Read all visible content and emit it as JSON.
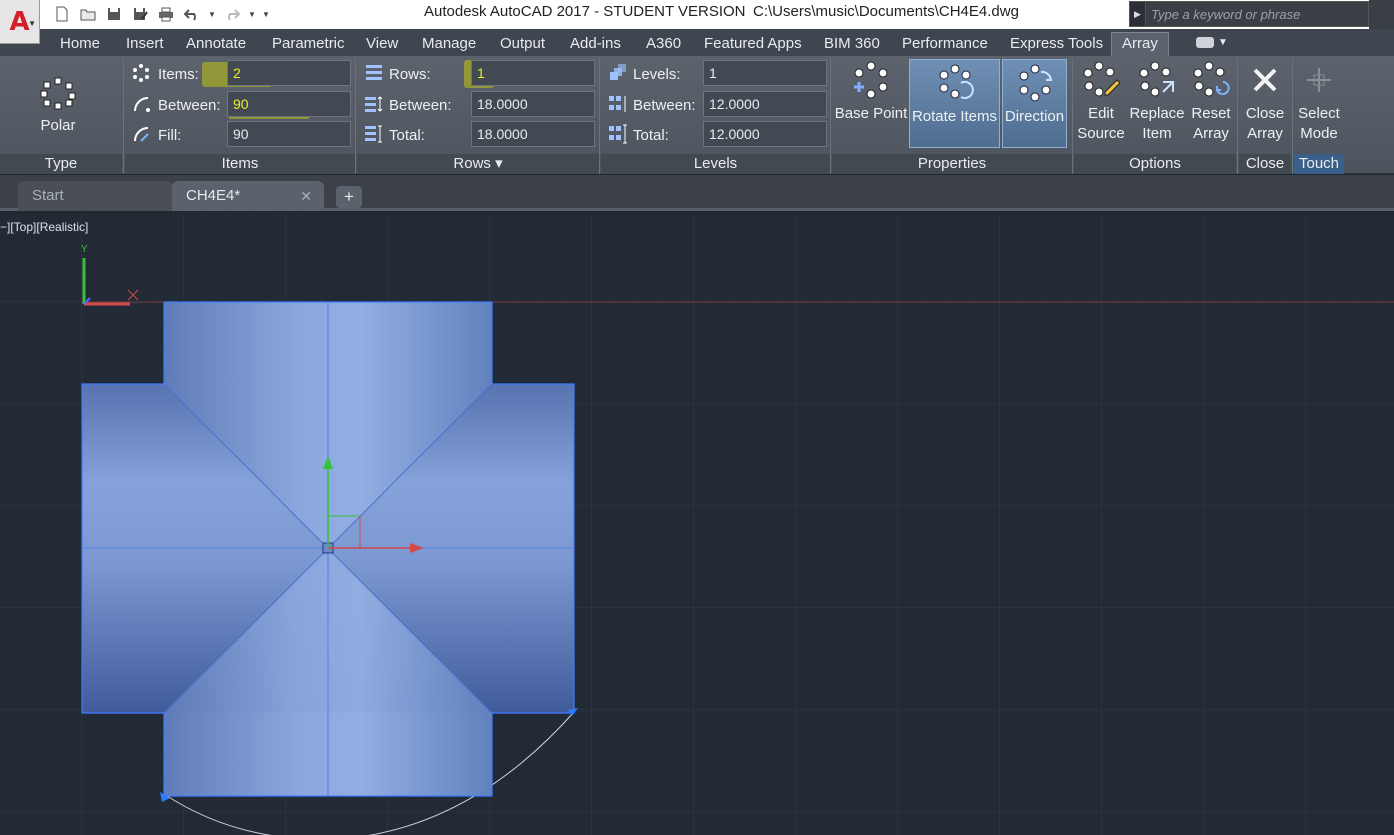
{
  "app": {
    "menu_letter": "A",
    "title": "Autodesk AutoCAD 2017 - STUDENT VERSION",
    "file_path": "C:\\Users\\music\\Documents\\CH4E4.dwg",
    "search_placeholder": "Type a keyword or phrase"
  },
  "ribbon_tabs": [
    "Home",
    "Insert",
    "Annotate",
    "Parametric",
    "View",
    "Manage",
    "Output",
    "Add-ins",
    "A360",
    "Featured Apps",
    "BIM 360",
    "Performance",
    "Express Tools",
    "Array"
  ],
  "active_tab": "Array",
  "panels": {
    "type": {
      "title": "Type",
      "button": "Polar"
    },
    "items": {
      "title": "Items",
      "items_label": "Items:",
      "items_value": "2",
      "between_label": "Between:",
      "between_value": "90",
      "fill_label": "Fill:",
      "fill_value": "90"
    },
    "rows": {
      "title": "Rows",
      "rows_label": "Rows:",
      "rows_value": "1",
      "between_label": "Between:",
      "between_value": "18.0000",
      "total_label": "Total:",
      "total_value": "18.0000"
    },
    "levels": {
      "title": "Levels",
      "levels_label": "Levels:",
      "levels_value": "1",
      "between_label": "Between:",
      "between_value": "12.0000",
      "total_label": "Total:",
      "total_value": "12.0000"
    },
    "properties": {
      "title": "Properties",
      "base_point": "Base Point",
      "rotate_items": "Rotate Items",
      "direction": "Direction"
    },
    "options": {
      "title": "Options",
      "edit_line1": "Edit",
      "edit_line2": "Source",
      "replace_line1": "Replace",
      "replace_line2": "Item",
      "reset_line1": "Reset",
      "reset_line2": "Array"
    },
    "close": {
      "title": "Close",
      "line1": "Close",
      "line2": "Array"
    },
    "touch": {
      "title": "Touch",
      "line1": "Select",
      "line2": "Mode"
    }
  },
  "doc_tabs": {
    "start": "Start",
    "current": "CH4E4*",
    "close_glyph": "✕",
    "new_tab_glyph": "+"
  },
  "viewport_label": "−][Top][Realistic]",
  "ucs": {
    "y_label": "Y"
  },
  "colors": {
    "ribbon": "#525962",
    "canvas_bg": "#222a35",
    "grid": "#2b3340",
    "solid_fill": "#7b98d0",
    "selection": "#3f7dff",
    "highlight": "#d7dc00"
  }
}
